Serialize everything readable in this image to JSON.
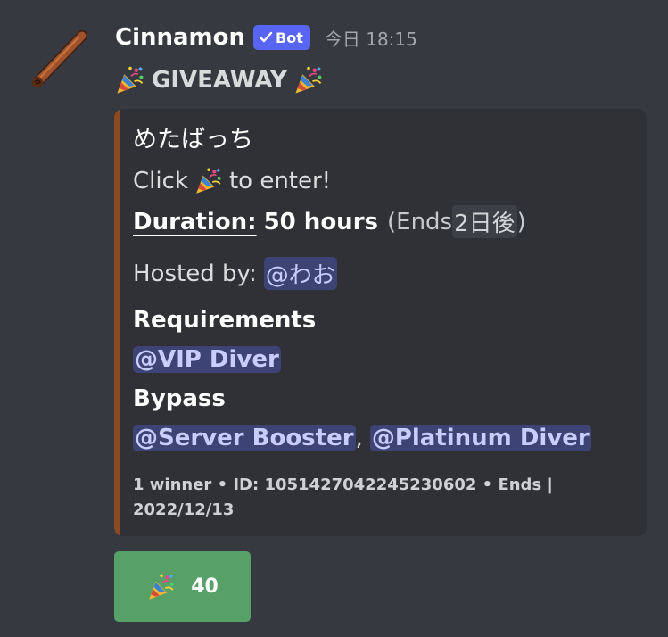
{
  "message": {
    "username": "Cinnamon",
    "bot_tag": "Bot",
    "timestamp": "今日 18:15",
    "content": "GIVEAWAY"
  },
  "embed": {
    "accent_color": "#8b4a1f",
    "title": "めたばっち",
    "click_prefix": "Click",
    "click_suffix": "to enter!",
    "duration_label": "Duration:",
    "duration_value": "50 hours",
    "ends_prefix": "(Ends",
    "ends_time": "2日後",
    "ends_suffix": ")",
    "hosted_label": "Hosted by:",
    "host_mention": "@わお",
    "requirements_heading": "Requirements",
    "requirements_mentions": [
      "@VIP Diver"
    ],
    "bypass_heading": "Bypass",
    "bypass_mentions": [
      "@Server Booster",
      "@Platinum Diver"
    ],
    "bypass_separator": ",",
    "footer": "1 winner • ID: 1051427042245230602 • Ends | 2022/12/13"
  },
  "reaction": {
    "emoji": "party-popper-icon",
    "count": "40",
    "color": "#57a168"
  },
  "colors": {
    "background": "#36393f",
    "embed_background": "#2f3136",
    "mention_background": "#3e4375",
    "bot_tag": "#5865f2"
  }
}
